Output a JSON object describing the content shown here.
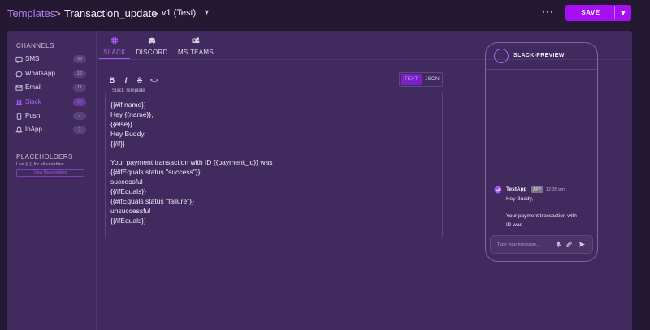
{
  "header": {
    "root_crumb": "Templates",
    "separator": ">",
    "template_name": "Transaction_update",
    "version": "v1 (Test)",
    "more_label": "···",
    "save_label": "SAVE"
  },
  "sidebar": {
    "channels_heading": "CHANNELS",
    "channels": [
      {
        "label": "SMS",
        "count": "30",
        "icon": "sms-icon"
      },
      {
        "label": "WhatsApp",
        "count": "16",
        "icon": "whatsapp-icon"
      },
      {
        "label": "Email",
        "count": "11",
        "icon": "email-icon"
      },
      {
        "label": "Slack",
        "count": "10",
        "icon": "slack-icon",
        "active": true
      },
      {
        "label": "Push",
        "count": "7",
        "icon": "push-icon"
      },
      {
        "label": "InApp",
        "count": "1",
        "icon": "inapp-icon"
      }
    ],
    "placeholders_heading": "PLACEHOLDERS",
    "placeholders_hint": "Use {{ }} for all variables",
    "placeholders_button": "View Placeholders"
  },
  "tabs": [
    {
      "label": "SLACK",
      "icon": "slack-icon",
      "active": true
    },
    {
      "label": "DISCORD",
      "icon": "discord-icon"
    },
    {
      "label": "MS TEAMS",
      "icon": "ms-teams-icon"
    }
  ],
  "toolbar": {
    "bold": "B",
    "italic": "I",
    "strike": "S",
    "code": "<>",
    "mode_text": "TEXT",
    "mode_json": "JSON"
  },
  "editor": {
    "legend": "Slack Template",
    "lines": [
      "{{#if name}}",
      "Hey {{name}},",
      "{{else}}",
      "Hey Buddy,",
      "{{/if}}",
      "",
      "Your payment transaction with ID {{payment_id}} was",
      "{{#ifEquals status \"success\"}}",
      "successful",
      "{{/ifEquals}}",
      "{{#ifEquals status \"failure\"}}",
      "unsuccessful",
      "{{/ifEquals}}"
    ]
  },
  "preview": {
    "title": "SLACK-PREVIEW",
    "app_name": "TestApp",
    "badge": "APP",
    "time": "12:35 pm",
    "message_lines": [
      "Hey Buddy,",
      "",
      "Your payment transaction with",
      "ID was"
    ],
    "input_placeholder": "Type your message..."
  },
  "colors": {
    "accent": "#a60ff0",
    "active_text": "#b067f3",
    "panel": "#402a5e",
    "background": "#241833"
  }
}
